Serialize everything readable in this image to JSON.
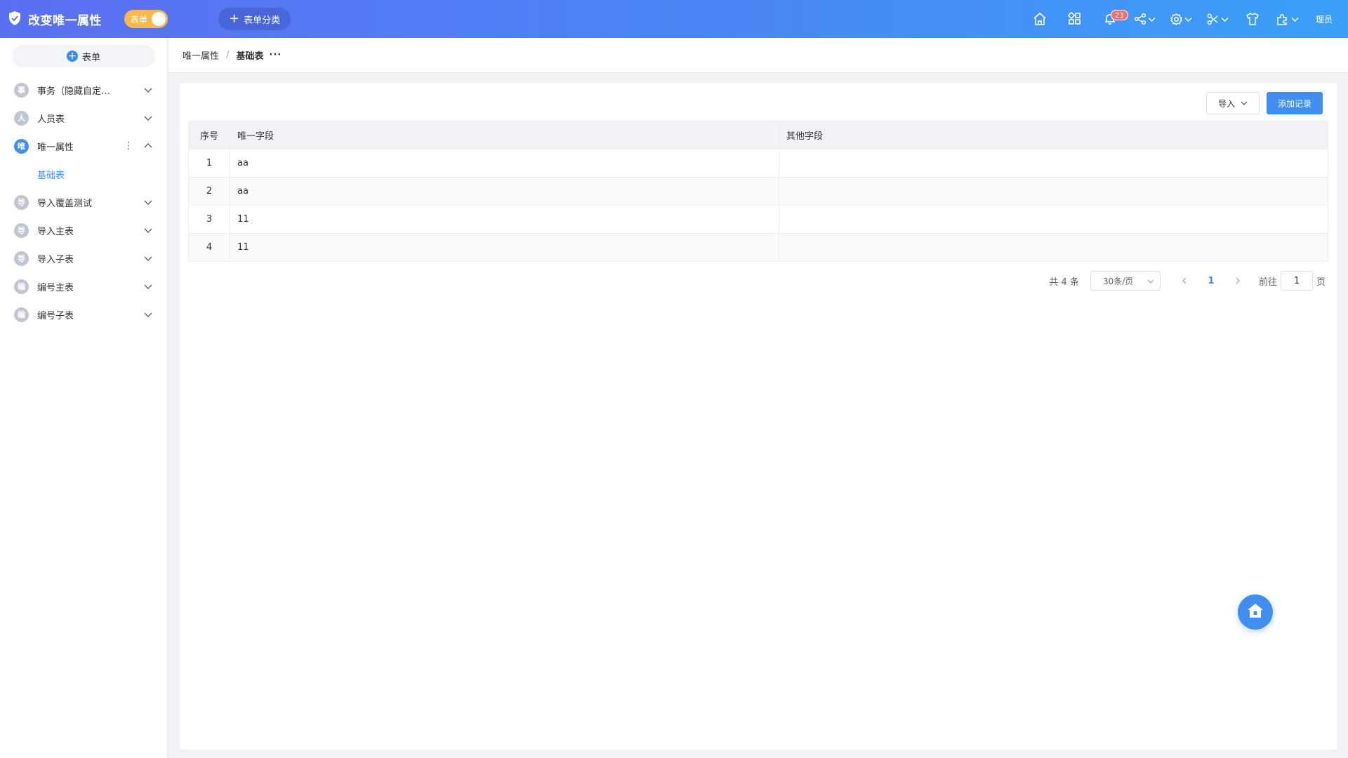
{
  "header": {
    "title": "改变唯一属性",
    "toggle_label": "表单",
    "add_category": "表单分类",
    "notification_count": "23",
    "user": "理员",
    "icons": [
      "home-icon",
      "apps-icon",
      "bell-icon",
      "share-icon",
      "gear-icon",
      "tools-icon",
      "shirt-icon",
      "puzzle-icon"
    ]
  },
  "sidebar": {
    "add_button": "表单",
    "items": [
      {
        "badge": "事",
        "label": "事务（隐藏自定…",
        "expanded": false
      },
      {
        "badge": "人",
        "label": "人员表",
        "expanded": false
      },
      {
        "badge": "唯",
        "label": "唯一属性",
        "expanded": true,
        "active": true,
        "children": [
          "基础表"
        ]
      },
      {
        "badge": "导",
        "label": "导入覆盖测试",
        "expanded": false
      },
      {
        "badge": "导",
        "label": "导入主表",
        "expanded": false
      },
      {
        "badge": "导",
        "label": "导入子表",
        "expanded": false
      },
      {
        "badge": "编",
        "label": "编号主表",
        "expanded": false
      },
      {
        "badge": "编",
        "label": "编号子表",
        "expanded": false
      }
    ]
  },
  "breadcrumb": {
    "parent": "唯一属性",
    "separator": "/",
    "current": "基础表",
    "more": "···"
  },
  "toolbar": {
    "import_label": "导入",
    "add_label": "添加记录"
  },
  "table": {
    "columns": [
      "序号",
      "唯一字段",
      "其他字段"
    ],
    "rows": [
      [
        "1",
        "aa",
        ""
      ],
      [
        "2",
        "aa",
        ""
      ],
      [
        "3",
        "11",
        ""
      ],
      [
        "4",
        "11",
        ""
      ]
    ]
  },
  "pagination": {
    "total": "共 4 条",
    "page_size": "30条/页",
    "current_page": "1",
    "goto_prefix": "前往",
    "goto_value": "1",
    "goto_suffix": "页"
  },
  "colors": {
    "primary": "#3f8ef0",
    "header_start": "#5b6ff2",
    "header_end": "#3aa0f7",
    "toggle": "#f6b94a",
    "badge": "#f56c6c"
  }
}
